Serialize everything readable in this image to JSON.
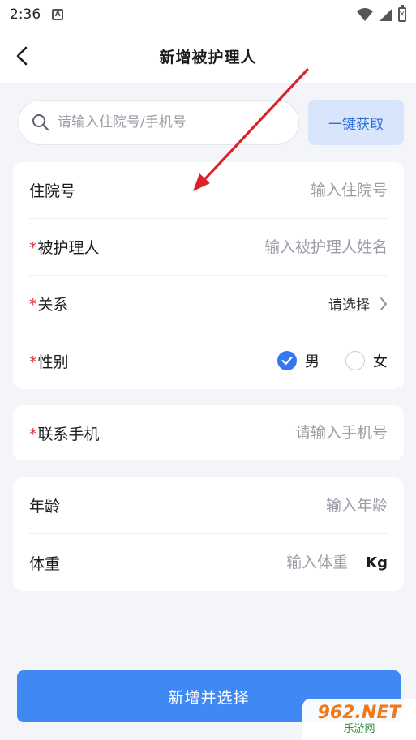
{
  "status_bar": {
    "time": "2:36",
    "app_icon_letter": "A"
  },
  "nav": {
    "title": "新增被护理人"
  },
  "search": {
    "placeholder": "请输入住院号/手机号",
    "value": "",
    "fetch_label": "一键获取"
  },
  "form": {
    "hospital_no": {
      "label": "住院号",
      "placeholder": "输入住院号"
    },
    "patient_name": {
      "required_mark": "*",
      "label": "被护理人",
      "placeholder": "输入被护理人姓名"
    },
    "relation": {
      "required_mark": "*",
      "label": "关系",
      "placeholder": "请选择"
    },
    "gender": {
      "required_mark": "*",
      "label": "性别",
      "options": [
        {
          "label": "男",
          "selected": true
        },
        {
          "label": "女",
          "selected": false
        }
      ]
    },
    "phone": {
      "required_mark": "*",
      "label": "联系手机",
      "placeholder": "请输入手机号"
    },
    "age": {
      "label": "年龄",
      "placeholder": "输入年龄"
    },
    "weight": {
      "label": "体重",
      "placeholder": "输入体重",
      "unit": "Kg"
    }
  },
  "submit": {
    "label": "新增并选择"
  },
  "watermark": {
    "brand": "962.NET",
    "sub": "乐游网"
  },
  "colors": {
    "primary": "#4088f4",
    "fetch_bg": "#d9e5fb",
    "required": "#e5303a",
    "annotation": "#d8232a"
  }
}
